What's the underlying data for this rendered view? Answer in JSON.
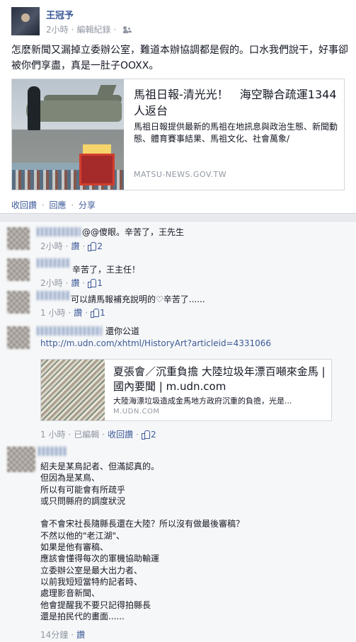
{
  "post": {
    "author": "王冠予",
    "time": "2小時",
    "edit_history": "編輯紀錄",
    "status_text": "怎麽新聞又漏掉立委辦公室，難道本辦協調都是假的。口水我們說干，好事卻被你們享盡，真是一肚子OOXX。",
    "link": {
      "title": "馬祖日報-清光光！　海空聯合疏運1344人返台",
      "description": "馬祖日報提供最新的馬祖在地訊息與政治生態、新聞動態、體育賽事結果、馬祖文化、社會萬象/",
      "domain": "MATSU-NEWS.GOV.TW"
    },
    "actions": {
      "unlike": "收回讚",
      "reply": "回應",
      "share": "分享"
    }
  },
  "comments": [
    {
      "text": "@@傻眼。辛苦了，王先生",
      "time": "2小時",
      "like": "讚",
      "likes": "2"
    },
    {
      "text": "辛苦了，王主任！",
      "time": "2小時",
      "like": "讚",
      "likes": "1"
    },
    {
      "text": "可以請馬報補充說明的♡辛苦了......",
      "time": "1 小時",
      "like": "讚",
      "likes": "1"
    },
    {
      "text": "還你公道",
      "url": "http://m.udn.com/xhtml/HistoryArt?articleid=4331066",
      "share": {
        "title": "夏張會／沉重負擔 大陸垃圾年漂百噸來金馬 | 國內要聞 | m.udn.com",
        "description": "大陸海漂垃圾造成金馬地方政府沉重的負擔，光是...",
        "domain": "M.UDN.COM"
      },
      "time": "1 小時",
      "edited": "已編輯",
      "unlike": "收回讚",
      "likes": "2"
    },
    {
      "text": "紹夫是某鳥記者、但滿認真的。\n但因為是某鳥、\n所以有可能會有所疏乎\n或只問縣府的調度狀況\n\n會不會宋社長隨縣長還在大陸？所以沒有做最後審稿？\n不然以他的\"老江湖\"、\n如果是他有審稿、\n應該會懂得每次的軍機協助輸運\n立委辦公室是最大出力者、\n以前我短短當特約記者時、\n處理影音新聞、\n他會提醒我不要只記得拍縣長\n還是拍民代的畫面......",
      "time": "14分鐘",
      "like": "讚"
    }
  ]
}
